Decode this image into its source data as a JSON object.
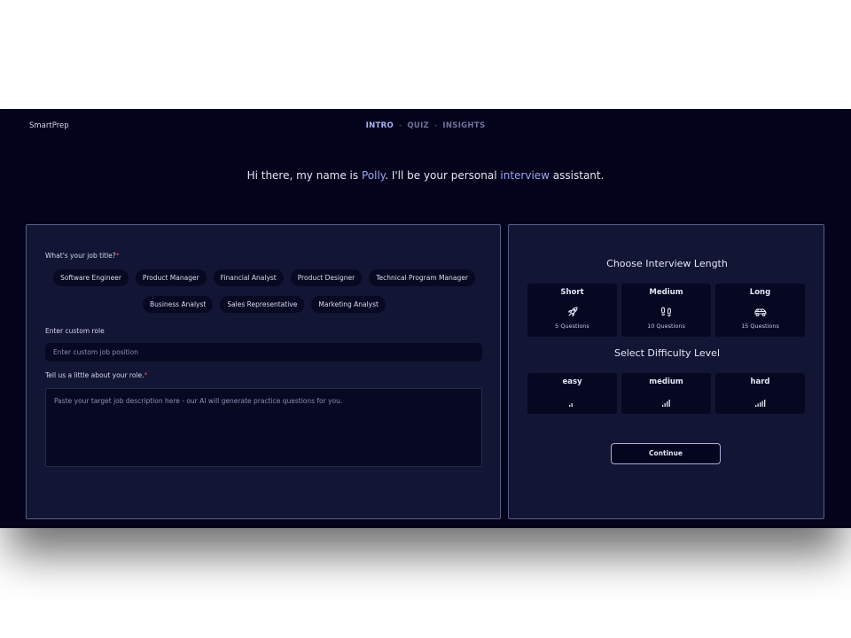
{
  "header": {
    "brand": "SmartPrep",
    "tabs": [
      {
        "label": "INTRO"
      },
      {
        "label": "QUIZ"
      },
      {
        "label": "INSIGHTS"
      }
    ],
    "separator": "-"
  },
  "greeting": {
    "before": "Hi there, my name is ",
    "name": "Polly",
    "middle": ". I'll be your personal ",
    "keyword": "interview",
    "after": " assistant."
  },
  "job_form": {
    "job_title_label": "What's your job title?",
    "required_mark": "*",
    "role_chips_row1": [
      "Software Engineer",
      "Product Manager",
      "Financial Analyst",
      "Product Designer",
      "Technical Program Manager"
    ],
    "role_chips_row2": [
      "Business Analyst",
      "Sales Representative",
      "Marketing Analyst"
    ],
    "custom_role_label": "Enter custom role",
    "custom_role_placeholder": "Enter custom job position",
    "custom_role_value": "",
    "description_label": "Tell us a little about your role.",
    "description_placeholder": "Paste your target job description here - our AI will generate practice questions for you.",
    "description_value": ""
  },
  "interview_length": {
    "title": "Choose Interview Length",
    "options": [
      {
        "label": "Short",
        "sub": "5 Questions",
        "icon": "rocket-icon"
      },
      {
        "label": "Medium",
        "sub": "10 Questions",
        "icon": "footprints-icon"
      },
      {
        "label": "Long",
        "sub": "15 Questions",
        "icon": "car-icon"
      }
    ]
  },
  "difficulty": {
    "title": "Select Difficulty Level",
    "options": [
      {
        "label": "easy",
        "icon": "signal-low-icon"
      },
      {
        "label": "medium",
        "icon": "signal-medium-icon"
      },
      {
        "label": "hard",
        "icon": "signal-high-icon"
      }
    ]
  },
  "continue_label": "Continue",
  "colors": {
    "background": "#03041c",
    "panel": "#121533",
    "accent": "#9ea5ef",
    "required": "#e04848"
  }
}
